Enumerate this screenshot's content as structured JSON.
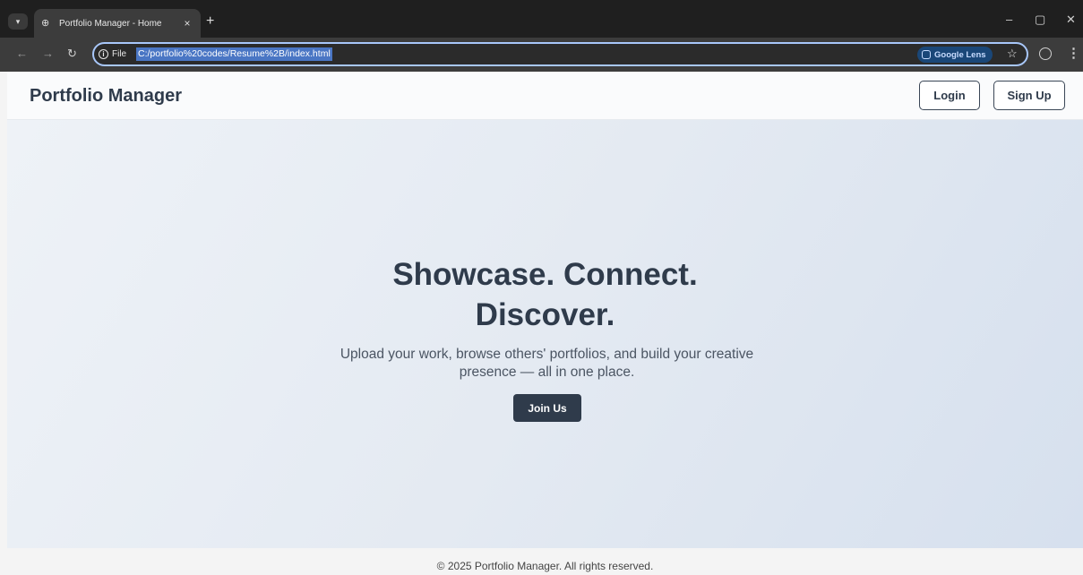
{
  "browser": {
    "tab_title": "Portfolio Manager - Home",
    "tab_close": "×",
    "new_tab": "+",
    "site_chip_label": "File",
    "url": "C:/portfolio%20codes/Resume%2B/index.html",
    "lens_label": "Google Lens",
    "window_controls": {
      "minimize": "–",
      "maximize": "▢",
      "close": "✕"
    }
  },
  "header": {
    "brand": "Portfolio Manager",
    "login_label": "Login",
    "signup_label": "Sign Up"
  },
  "hero": {
    "title_line1": "Showcase. Connect.",
    "title_line2": "Discover.",
    "subtitle": "Upload your work, browse others' portfolios, and build your creative presence — all in one place.",
    "cta_label": "Join Us"
  },
  "footer": {
    "text": "© 2025 Portfolio Manager. All rights reserved."
  },
  "colors": {
    "primary": "#2f3b4b",
    "hero_bg_start": "#eef2f7",
    "hero_bg_end": "#d6e0ee",
    "chrome_dark": "#1f1f1f",
    "omnibox_focus": "#a8c7fa"
  },
  "icons": [
    "tab-search-icon",
    "globe-icon",
    "close-icon",
    "plus-icon",
    "back-arrow-icon",
    "forward-arrow-icon",
    "reload-icon",
    "info-icon",
    "google-lens-icon",
    "star-icon",
    "profile-icon",
    "kebab-menu-icon",
    "minimize-icon",
    "maximize-icon"
  ]
}
